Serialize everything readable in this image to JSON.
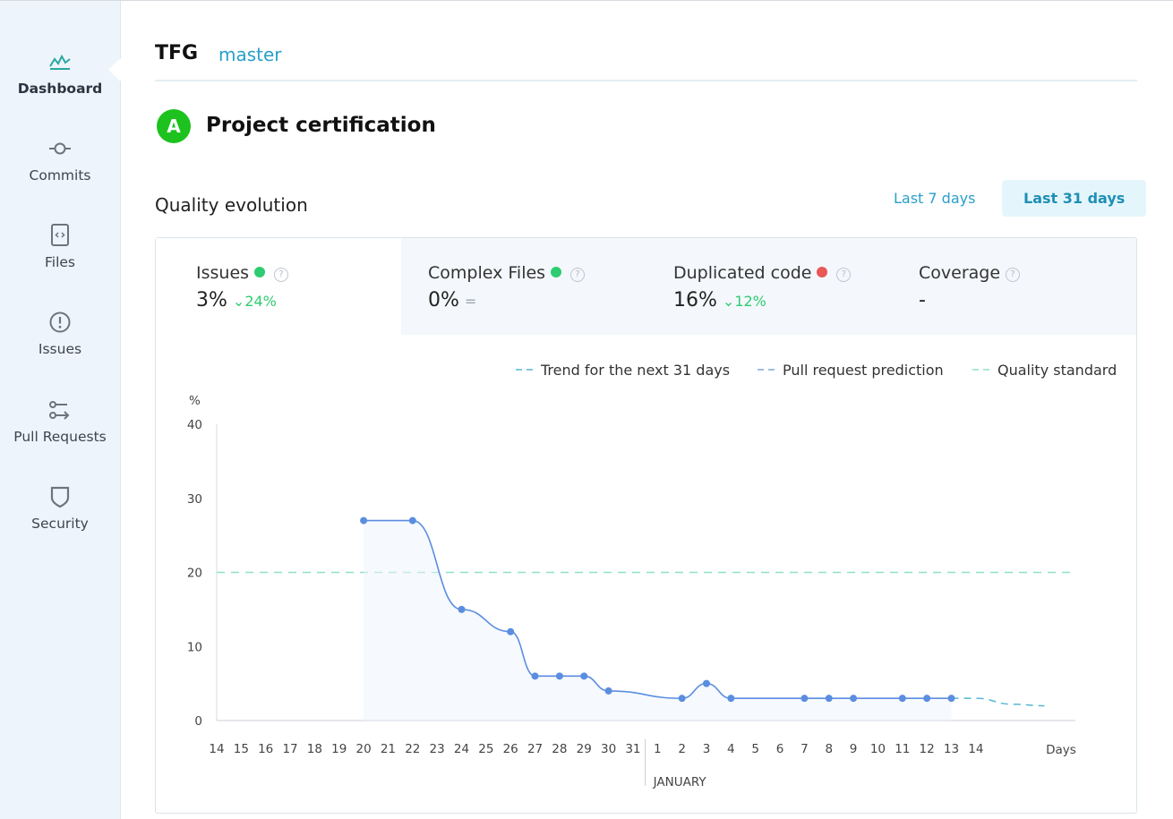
{
  "sidebar": {
    "items": [
      {
        "label": "Dashboard",
        "icon": "dashboard-icon",
        "active": true
      },
      {
        "label": "Commits",
        "icon": "commit-icon"
      },
      {
        "label": "Files",
        "icon": "file-code-icon"
      },
      {
        "label": "Issues",
        "icon": "alert-circle-icon"
      },
      {
        "label": "Pull Requests",
        "icon": "pull-request-icon"
      },
      {
        "label": "Security",
        "icon": "shield-icon"
      }
    ]
  },
  "header": {
    "repo": "TFG",
    "branch": "master"
  },
  "certification": {
    "grade": "A",
    "title": "Project certification",
    "grade_color": "#1ec21e"
  },
  "quality": {
    "title": "Quality evolution",
    "ranges": [
      {
        "label": "Last 7 days"
      },
      {
        "label": "Last 31 days",
        "active": true
      }
    ]
  },
  "metrics": [
    {
      "label": "Issues",
      "value": "3%",
      "delta": "24%",
      "status_color": "#2ecc71"
    },
    {
      "label": "Complex Files",
      "value": "0%",
      "delta": "=",
      "status_color": "#2ecc71"
    },
    {
      "label": "Duplicated code",
      "value": "16%",
      "delta": "12%",
      "status_color": "#e95757"
    },
    {
      "label": "Coverage",
      "value": "-",
      "delta": ""
    }
  ],
  "chart_data": {
    "type": "line",
    "ylabel": "%",
    "xlabel": "Days",
    "ylim": [
      0,
      40
    ],
    "yticks": [
      0,
      10,
      20,
      30,
      40
    ],
    "x_tick_labels": [
      "14",
      "15",
      "16",
      "17",
      "18",
      "19",
      "20",
      "21",
      "22",
      "23",
      "24",
      "25",
      "26",
      "27",
      "28",
      "29",
      "30",
      "31",
      "1",
      "2",
      "3",
      "4",
      "5",
      "6",
      "7",
      "8",
      "9",
      "10",
      "11",
      "12",
      "13",
      "14"
    ],
    "month_label": "JANUARY",
    "month_break_after_index": 17,
    "legend": [
      "Trend for the next 31 days",
      "Pull request prediction",
      "Quality standard"
    ],
    "series": [
      {
        "name": "Duplicated code",
        "color": "#5b8de0",
        "points": [
          {
            "i": 6,
            "y": 27
          },
          {
            "i": 8,
            "y": 27
          },
          {
            "i": 10,
            "y": 15
          },
          {
            "i": 12,
            "y": 12
          },
          {
            "i": 13,
            "y": 6
          },
          {
            "i": 14,
            "y": 6
          },
          {
            "i": 15,
            "y": 6
          },
          {
            "i": 16,
            "y": 4
          },
          {
            "i": 19,
            "y": 3
          },
          {
            "i": 20,
            "y": 5
          },
          {
            "i": 21,
            "y": 3
          },
          {
            "i": 24,
            "y": 3
          },
          {
            "i": 25,
            "y": 3
          },
          {
            "i": 26,
            "y": 3
          },
          {
            "i": 28,
            "y": 3
          },
          {
            "i": 29,
            "y": 3
          },
          {
            "i": 30,
            "y": 3
          }
        ]
      },
      {
        "name": "Trend for the next 31 days",
        "color": "#56b8cf",
        "points": [
          {
            "i": 30,
            "y": 3
          },
          {
            "i": 31,
            "y": 3
          },
          {
            "i": 32.5,
            "y": 2.2
          },
          {
            "i": 33.8,
            "y": 2
          }
        ]
      }
    ],
    "quality_standard": {
      "y": 20,
      "color": "#8fe0c5"
    },
    "legend_colors": [
      "#56b8cf",
      "#7ea7d8",
      "#8fe0c5"
    ]
  }
}
